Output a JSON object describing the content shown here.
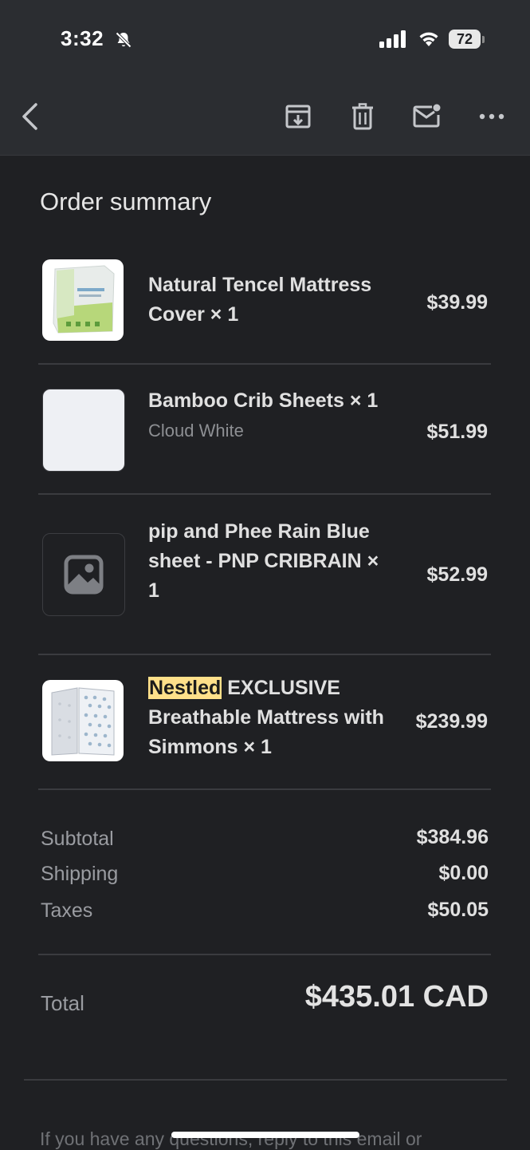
{
  "status_bar": {
    "time": "3:32",
    "battery": "72"
  },
  "toolbar": {
    "back_icon": "chevron-left-icon",
    "archive_icon": "archive-icon",
    "delete_icon": "trash-icon",
    "mark_unread_icon": "mail-unread-icon",
    "more_icon": "more-horizontal-icon"
  },
  "order": {
    "title": "Order summary",
    "items": [
      {
        "name": "Natural Tencel Mattress Cover × 1",
        "variant": "",
        "price": "$39.99"
      },
      {
        "name": "Bamboo Crib Sheets × 1",
        "variant": "Cloud White",
        "price": "$51.99"
      },
      {
        "name": "pip and Phee Rain Blue sheet - PNP CRIBRAIN × 1",
        "variant": "",
        "price": "$52.99"
      },
      {
        "name_highlight": "Nestled",
        "name_rest": " EXCLUSIVE Breathable Mattress with Simmons × 1",
        "variant": "",
        "price": "$239.99"
      }
    ],
    "summary": {
      "subtotal_label": "Subtotal",
      "subtotal_value": "$384.96",
      "shipping_label": "Shipping",
      "shipping_value": "$0.00",
      "taxes_label": "Taxes",
      "taxes_value": "$50.05",
      "total_label": "Total",
      "total_value": "$435.01 CAD"
    }
  },
  "footer": {
    "text": "If you have any questions, reply to this email or"
  },
  "colors": {
    "background": "#1f2023",
    "toolbar": "#2b2d31",
    "highlight": "#ffe08a"
  }
}
